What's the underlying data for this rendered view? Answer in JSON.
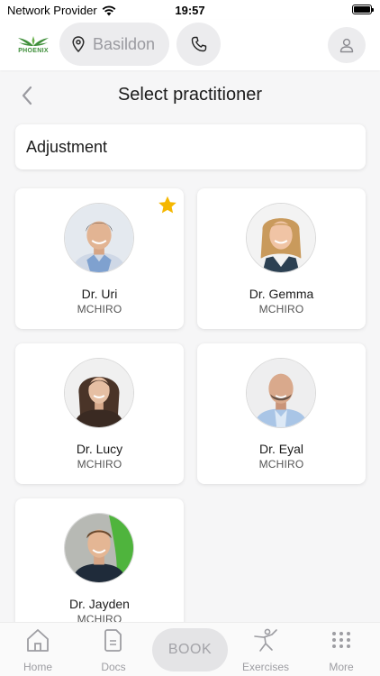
{
  "status_bar": {
    "carrier": "Network Provider",
    "time": "19:57"
  },
  "header": {
    "brand": "PHOENIX",
    "location": "Basildon"
  },
  "page": {
    "title": "Select practitioner",
    "service": "Adjustment"
  },
  "practitioners": [
    {
      "name": "Dr. Uri",
      "credential": "MCHIRO",
      "favorite": true
    },
    {
      "name": "Dr. Gemma",
      "credential": "MCHIRO",
      "favorite": false
    },
    {
      "name": "Dr. Lucy",
      "credential": "MCHIRO",
      "favorite": false
    },
    {
      "name": "Dr. Eyal",
      "credential": "MCHIRO",
      "favorite": false
    },
    {
      "name": "Dr. Jayden",
      "credential": "MCHIRO",
      "favorite": false
    }
  ],
  "tabbar": {
    "home": "Home",
    "docs": "Docs",
    "book": "BOOK",
    "exercises": "Exercises",
    "more": "More"
  },
  "icons": {
    "wifi": "wifi-icon",
    "battery": "battery-icon",
    "logo": "phoenix-wings-logo",
    "location": "map-pin-icon",
    "phone": "phone-icon",
    "profile": "user-icon",
    "back": "chevron-left-icon",
    "favorite": "star-icon",
    "home": "house-icon",
    "docs": "document-icon",
    "exercises": "stretching-person-icon",
    "more": "grid-dots-icon"
  },
  "colors": {
    "brand_green": "#3f8f3a",
    "star": "#f5b700",
    "tab_inactive": "#9d9da2",
    "background": "#f6f6f7"
  }
}
